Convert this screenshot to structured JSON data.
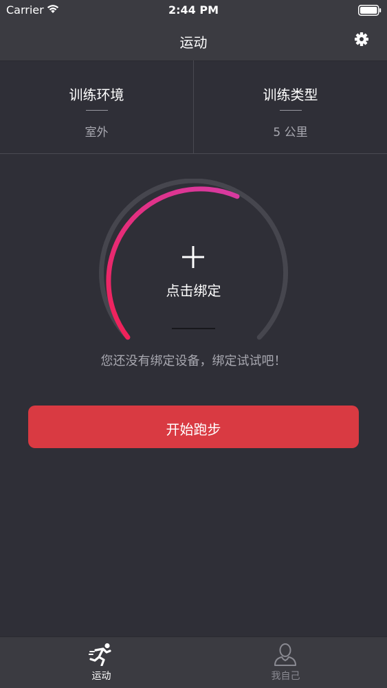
{
  "status_bar": {
    "carrier": "Carrier",
    "time": "2:44 PM"
  },
  "nav": {
    "title": "运动",
    "settings_icon": "gear-icon"
  },
  "segments": {
    "environment": {
      "title": "训练环境",
      "value": "室外"
    },
    "type": {
      "title": "训练类型",
      "value": "5 公里"
    }
  },
  "gauge": {
    "bind_label": "点击绑定",
    "add_icon": "plus-icon",
    "progress_colors": [
      "#f0225a",
      "#d83aa0"
    ],
    "track_color": "#46464e"
  },
  "hint": "您还没有绑定设备，绑定试试吧！",
  "start_button": {
    "label": "开始跑步",
    "color": "#d93a42"
  },
  "tabbar": {
    "tabs": [
      {
        "label": "运动",
        "icon": "running-icon",
        "active": true
      },
      {
        "label": "我自己",
        "icon": "person-icon",
        "active": false
      }
    ]
  }
}
